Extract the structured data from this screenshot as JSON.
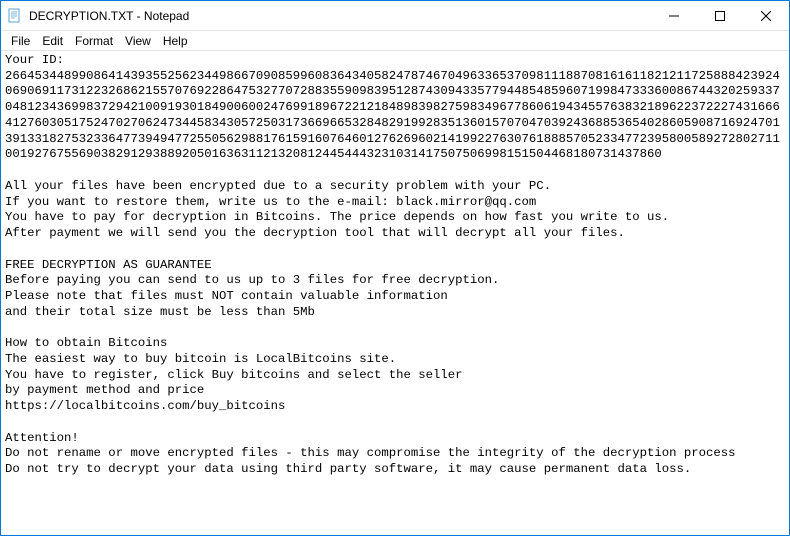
{
  "titlebar": {
    "title": "DECRYPTION.TXT - Notepad"
  },
  "menubar": {
    "file": "File",
    "edit": "Edit",
    "format": "Format",
    "view": "View",
    "help": "Help"
  },
  "content": {
    "id_label": "Your ID:",
    "id_value": "26645344899086414393552562344986670908599608364340582478746704963365370981118870816161182121172588842392406906911731223268621557076922864753277072883559098395128743094335779448548596071998473336008674432025933704812343699837294210091930184900600247699189672212184898398275983496778606194345576383218962237222743166641276030517524702706247344583430572503173669665328482919928351360157070470392436885365402860590871692470139133182753233647739494772550562988176159160764601276269602141992276307618885705233477239580058927280271100192767556903829129388920501636311213208124454443231031417507506998151504468180731437860",
    "encrypted_msg": "All your files have been encrypted due to a security problem with your PC.",
    "restore_msg": "If you want to restore them, write us to the e-mail: black.mirror@qq.com",
    "pay_msg": "You have to pay for decryption in Bitcoins. The price depends on how fast you write to us.",
    "after_payment_msg": "After payment we will send you the decryption tool that will decrypt all your files.",
    "free_header": "FREE DECRYPTION AS GUARANTEE",
    "free_line1": "Before paying you can send to us up to 3 files for free decryption.",
    "free_line2": "Please note that files must NOT contain valuable information",
    "free_line3": "and their total size must be less than 5Mb",
    "howto_header": "How to obtain Bitcoins",
    "howto_line1": "The easiest way to buy bitcoin is LocalBitcoins site.",
    "howto_line2": "You have to register, click Buy bitcoins and select the seller",
    "howto_line3": "by payment method and price",
    "howto_url": "https://localbitcoins.com/buy_bitcoins",
    "attention_header": "Attention!",
    "attention_line1": "Do not rename or move encrypted files - this may compromise the integrity of the decryption process",
    "attention_line2": "Do not try to decrypt your data using third party software, it may cause permanent data loss."
  }
}
